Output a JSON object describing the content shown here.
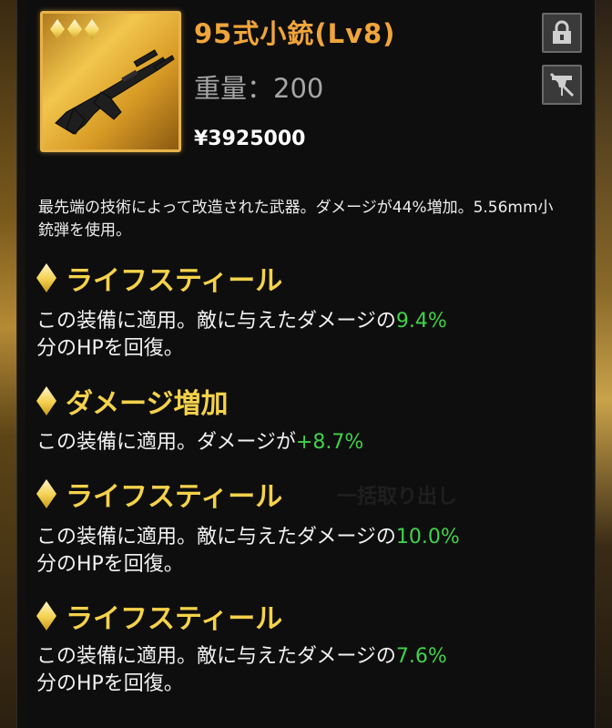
{
  "item": {
    "name": "95式小銃(Lv8)",
    "weight": "重量：200",
    "price": "¥3925000",
    "rarity_stars": 3,
    "image_icon": "assault-rifle-icon",
    "frame_color": "#e8b34a"
  },
  "buttons": {
    "lock_icon": "lock-icon",
    "unpin_icon": "unpin-icon"
  },
  "description": "最先端の技術によって改造された武器。ダメージが44%増加。5.56mm小銃弾を使用。",
  "watermark": "一括取り出し",
  "skills": [
    {
      "title": "ライフスティール",
      "text_pre": "この装備に適用。敵に与えたダメージの",
      "value": "9.4%",
      "text_post": "分のHPを回復。"
    },
    {
      "title": "ダメージ増加",
      "text_pre": "この装備に適用。ダメージが",
      "value": "+8.7%",
      "text_post": ""
    },
    {
      "title": "ライフスティール",
      "text_pre": "この装備に適用。敵に与えたダメージの",
      "value": "10.0%",
      "text_post": "分のHPを回復。"
    },
    {
      "title": "ライフスティール",
      "text_pre": "この装備に適用。敵に与えたダメージの",
      "value": "7.6%",
      "text_post": "分のHPを回復。"
    }
  ],
  "colors": {
    "name": "#f0a53a",
    "skill_title": "#f5d24a",
    "value": "#3fd24a"
  }
}
